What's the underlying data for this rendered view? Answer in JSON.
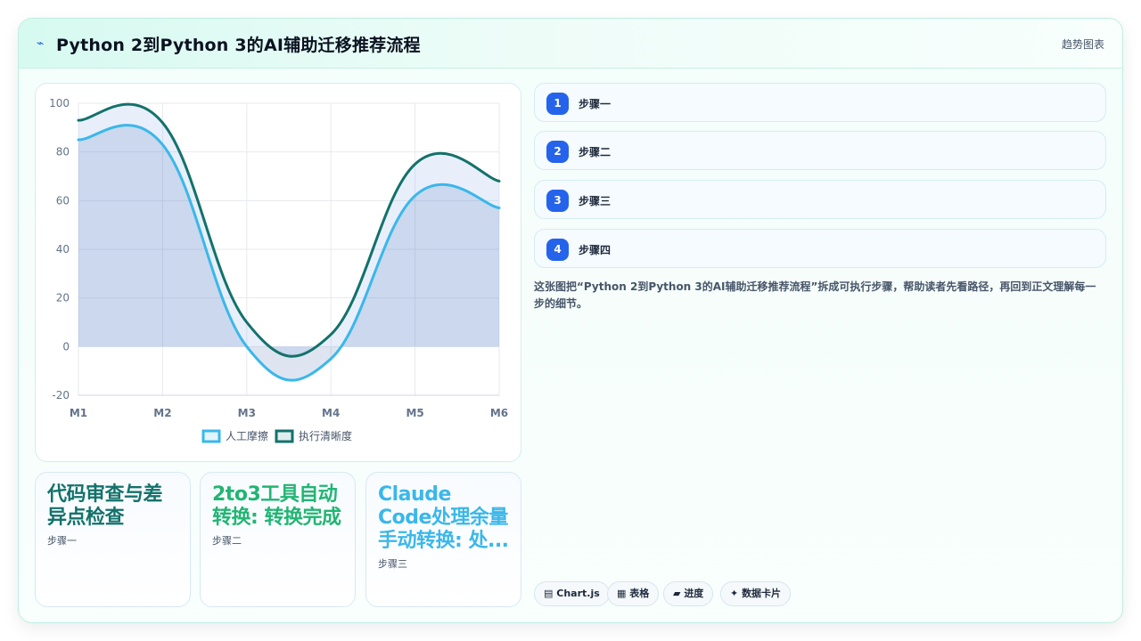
{
  "header": {
    "icon": "trend-line-icon",
    "title": "Python 2到Python 3的AI辅助迁移推荐流程",
    "right_label": "趋势图表"
  },
  "chart_data": {
    "type": "area",
    "x": [
      "M1",
      "M2",
      "M3",
      "M4",
      "M5",
      "M6"
    ],
    "ylim": [
      -20,
      100
    ],
    "yticks": [
      -20,
      0,
      20,
      40,
      60,
      80,
      100
    ],
    "grid": true,
    "legend_position": "bottom",
    "series": [
      {
        "name": "人工摩擦",
        "values": [
          85,
          83,
          0,
          -5,
          62,
          57
        ],
        "color": "#3bb7ea",
        "fill": "rgba(70,110,180,0.18)"
      },
      {
        "name": "执行清晰度",
        "values": [
          93,
          92,
          10,
          5,
          75,
          68
        ],
        "color": "#13726b",
        "fill": "rgba(150,180,235,0.22)"
      }
    ]
  },
  "stats": [
    {
      "title": "代码审查与差异点检查",
      "subtitle": "步骤一",
      "color": "#13726b"
    },
    {
      "title": "2to3工具自动转换: 转换完成",
      "subtitle": "步骤二",
      "color": "#22b573"
    },
    {
      "title": "Claude Code处理余量手动转换: 处...",
      "subtitle": "步骤三",
      "color": "#3bb7ea"
    }
  ],
  "steps": [
    {
      "num": "1",
      "label": "步骤一"
    },
    {
      "num": "2",
      "label": "步骤二"
    },
    {
      "num": "3",
      "label": "步骤三"
    },
    {
      "num": "4",
      "label": "步骤四"
    }
  ],
  "description": "这张图把“Python 2到Python 3的AI辅助迁移推荐流程”拆成可执行步骤，帮助读者先看路径，再回到正文理解每一步的细节。",
  "chips": [
    {
      "icon": "chart-icon",
      "glyph": "▤",
      "label": "Chart.js"
    },
    {
      "icon": "table-icon",
      "glyph": "▦",
      "label": "表格"
    },
    {
      "icon": "progress-icon",
      "glyph": "▰",
      "label": "进度"
    },
    {
      "icon": "sparkle-icon",
      "glyph": "✦",
      "label": "数据卡片"
    }
  ]
}
